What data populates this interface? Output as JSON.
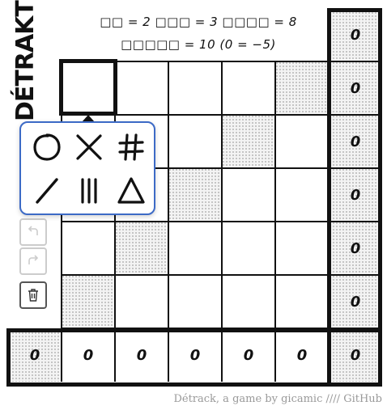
{
  "rules": {
    "line1": "□□ = 2    □□□ = 3    □□□□ = 8",
    "line2": "□□□□□ = 10    (0 = −5)"
  },
  "title": "DÉTRAKT",
  "grid": {
    "dotted_cells": [
      [
        0,
        4
      ],
      [
        1,
        3
      ],
      [
        2,
        2
      ],
      [
        3,
        1
      ],
      [
        4,
        0
      ]
    ],
    "row_scores": [
      "0",
      "0",
      "0",
      "0",
      "0",
      "0"
    ],
    "col_scores": [
      "0",
      "0",
      "0",
      "0",
      "0",
      "0"
    ],
    "total": "0"
  },
  "popup": {
    "shapes": [
      "circle-icon",
      "cross-icon",
      "hash-icon",
      "slash-icon",
      "triple-bar-icon",
      "triangle-icon"
    ]
  },
  "footer": {
    "text": "Détrack, a game by gicamic",
    "separator": "////",
    "link": "GitHub"
  }
}
